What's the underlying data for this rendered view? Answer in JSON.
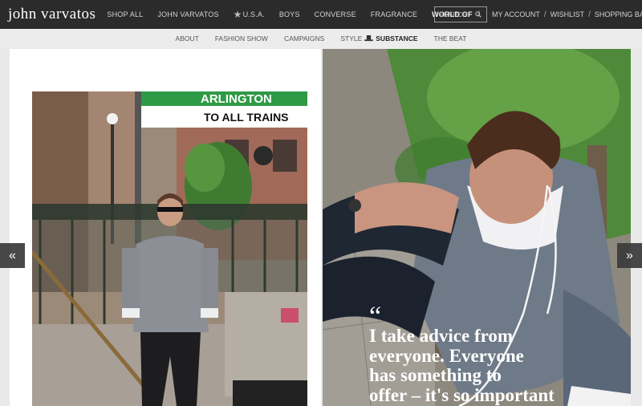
{
  "brand": {
    "logo": "john varvatos"
  },
  "main_nav": [
    {
      "label": "SHOP ALL"
    },
    {
      "label": "JOHN VARVATOS"
    },
    {
      "label": "U.S.A.",
      "icon": "star-icon"
    },
    {
      "label": "BOYS"
    },
    {
      "label": "CONVERSE"
    },
    {
      "label": "FRAGRANCE"
    },
    {
      "label": "WORLD OF",
      "active": true
    }
  ],
  "nav_separator": "/",
  "search": {
    "placeholder": "SEARCH",
    "icon": "search-icon"
  },
  "account": {
    "my_account": "MY ACCOUNT",
    "wishlist": "WISHLIST",
    "shopping_bag": "SHOPPING BAG",
    "separator": "/"
  },
  "sub_nav": [
    {
      "label": "ABOUT"
    },
    {
      "label": "FASHION SHOW"
    },
    {
      "label": "CAMPAIGNS"
    },
    {
      "label_prefix": "STYLE",
      "icon": "top-hat-icon",
      "label_suffix": "SUBSTANCE"
    },
    {
      "label": "THE BEAT"
    }
  ],
  "photo_left": {
    "sign_line1": "ARLINGTON",
    "sign_line2": "TO ALL TRAINS"
  },
  "carousel": {
    "prev_icon": "double-chevron-left-icon",
    "next_icon": "double-chevron-right-icon",
    "prev": "«",
    "next": "»"
  },
  "quote": {
    "mark": "“",
    "lines": [
      "I take advice from",
      "everyone. Everyone",
      "has something to",
      "offer – it's so important"
    ]
  },
  "colors": {
    "topbar": "#2b2b2b",
    "subnav": "#ececec",
    "sign_green": "#2f9a45",
    "page_bg": "#e9e9e9"
  }
}
